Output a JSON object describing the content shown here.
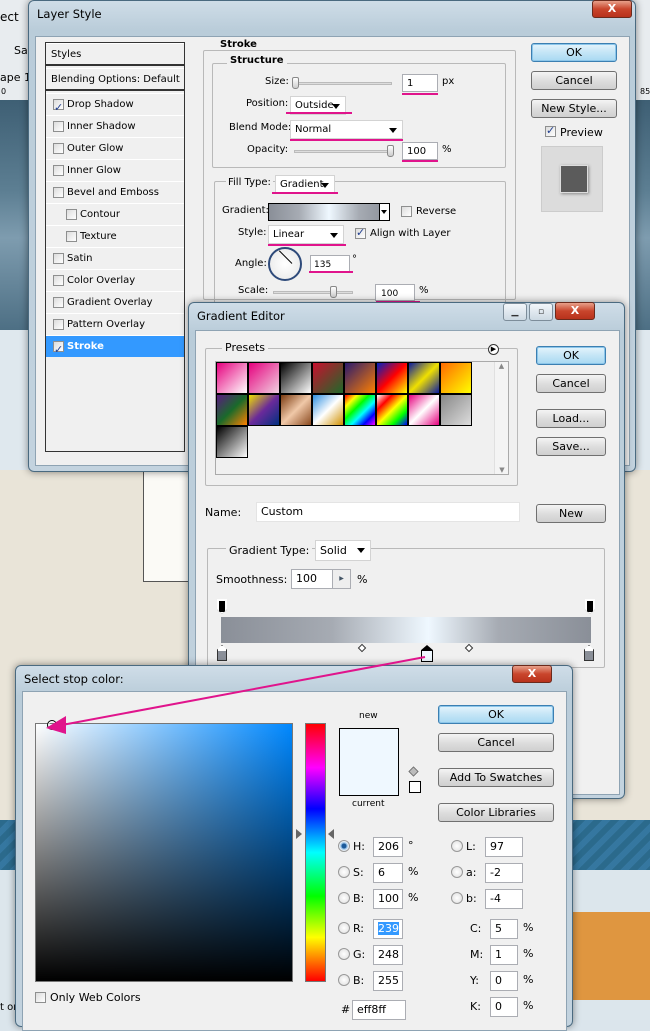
{
  "background": {
    "fragments": [
      "ect",
      "Sa",
      "ape 1",
      "0",
      "85",
      "t or"
    ]
  },
  "layer_style": {
    "title": "Layer Style",
    "close": "X",
    "styles_header": "Styles",
    "blending": "Blending Options: Default",
    "items": [
      {
        "label": "Drop Shadow",
        "checked": true
      },
      {
        "label": "Inner Shadow",
        "checked": false
      },
      {
        "label": "Outer Glow",
        "checked": false
      },
      {
        "label": "Inner Glow",
        "checked": false
      },
      {
        "label": "Bevel and Emboss",
        "checked": false
      },
      {
        "label": "Contour",
        "checked": false,
        "indent": true
      },
      {
        "label": "Texture",
        "checked": false,
        "indent": true
      },
      {
        "label": "Satin",
        "checked": false
      },
      {
        "label": "Color Overlay",
        "checked": false
      },
      {
        "label": "Gradient Overlay",
        "checked": false
      },
      {
        "label": "Pattern Overlay",
        "checked": false
      },
      {
        "label": "Stroke",
        "checked": true,
        "selected": true
      }
    ],
    "stroke": {
      "title": "Stroke",
      "structure": "Structure",
      "size_label": "Size:",
      "size": "1",
      "size_unit": "px",
      "size_fraction": 0.0,
      "position_label": "Position:",
      "position": "Outside",
      "blend_label": "Blend Mode:",
      "blend": "Normal",
      "opacity_label": "Opacity:",
      "opacity": "100",
      "opacity_unit": "%",
      "opacity_fraction": 1.0,
      "fill_type_label": "Fill Type:",
      "fill_type": "Gradient",
      "gradient_label": "Gradient:",
      "reverse": "Reverse",
      "reverse_checked": false,
      "style_label": "Style:",
      "style": "Linear",
      "align": "Align with Layer",
      "align_checked": true,
      "angle_label": "Angle:",
      "angle": "135",
      "angle_unit": "°",
      "scale_label": "Scale:",
      "scale": "100",
      "scale_unit": "%"
    },
    "buttons": {
      "ok": "OK",
      "cancel": "Cancel",
      "new_style": "New Style...",
      "preview": "Preview",
      "preview_checked": true
    }
  },
  "gradient_editor": {
    "title": "Gradient Editor",
    "presets_label": "Presets",
    "presets": [
      [
        "#e6007e",
        "#ffffff"
      ],
      [
        "#e6007e",
        "#f0d0e0"
      ],
      [
        "#000000",
        "#ffffff"
      ],
      [
        "#c8102e",
        "#1e6a2a"
      ],
      [
        "#2a1a6e",
        "#ff8000"
      ],
      [
        "#0020c0",
        "#ff0000",
        "#ffff00"
      ],
      [
        "#0a1aa0",
        "#f0e000",
        "#0a1aa0"
      ],
      [
        "#ff6a00",
        "#ffff00"
      ],
      [
        "#5a1a80",
        "#1a6a2a",
        "#ff8000"
      ],
      [
        "#f0e000",
        "#6a2a9a",
        "#003080"
      ],
      [
        "#7a3a10",
        "#f0c8a8",
        "#8a4a20"
      ],
      [
        "#3090e0",
        "#ffffff",
        "#d09000"
      ],
      [
        "#ff0000",
        "#ffff00",
        "#00ff00",
        "#00ffff",
        "#0000ff",
        "#ff00ff"
      ],
      [
        "#ffffff",
        "#ff0000",
        "#ffff00",
        "#00ff00",
        "#0000ff"
      ],
      [
        "#e6007e",
        "#ffffff",
        "#e6007e"
      ],
      [
        "#888888",
        "#dddddd"
      ],
      [
        "#000000",
        "#ffffff"
      ]
    ],
    "name_label": "Name:",
    "name": "Custom",
    "gradient_type_label": "Gradient Type:",
    "gradient_type": "Solid",
    "smoothness_label": "Smoothness:",
    "smoothness": "100",
    "smoothness_unit": "%",
    "gradient_colors": [
      "#8a8f98",
      "#a6abb3",
      "#eff8ff",
      "#a6abb3",
      "#8a8f98"
    ],
    "buttons": {
      "ok": "OK",
      "cancel": "Cancel",
      "load": "Load...",
      "save": "Save...",
      "new": "New"
    }
  },
  "color_picker": {
    "title": "Select stop color:",
    "new_label": "new",
    "current_label": "current",
    "new_color": "#eff8ff",
    "current_color": "#eff8ff",
    "hue_color": "#0088ff",
    "only_web": "Only Web Colors",
    "buttons": {
      "ok": "OK",
      "cancel": "Cancel",
      "add": "Add To Swatches",
      "libraries": "Color Libraries"
    },
    "hsb": [
      {
        "label": "H:",
        "value": "206",
        "unit": "°",
        "selected": true
      },
      {
        "label": "S:",
        "value": "6",
        "unit": "%"
      },
      {
        "label": "B:",
        "value": "100",
        "unit": "%"
      }
    ],
    "rgb": [
      {
        "label": "R:",
        "value": "239"
      },
      {
        "label": "G:",
        "value": "248"
      },
      {
        "label": "B:",
        "value": "255"
      }
    ],
    "lab": [
      {
        "label": "L:",
        "value": "97"
      },
      {
        "label": "a:",
        "value": "-2"
      },
      {
        "label": "b:",
        "value": "-4"
      }
    ],
    "cmyk": [
      {
        "label": "C:",
        "value": "5",
        "unit": "%"
      },
      {
        "label": "M:",
        "value": "1",
        "unit": "%"
      },
      {
        "label": "Y:",
        "value": "0",
        "unit": "%"
      },
      {
        "label": "K:",
        "value": "0",
        "unit": "%"
      }
    ],
    "hex_label": "#",
    "hex": "eff8ff"
  },
  "colors": {
    "annotation": "#e0148c",
    "selection": "#3399ff"
  }
}
